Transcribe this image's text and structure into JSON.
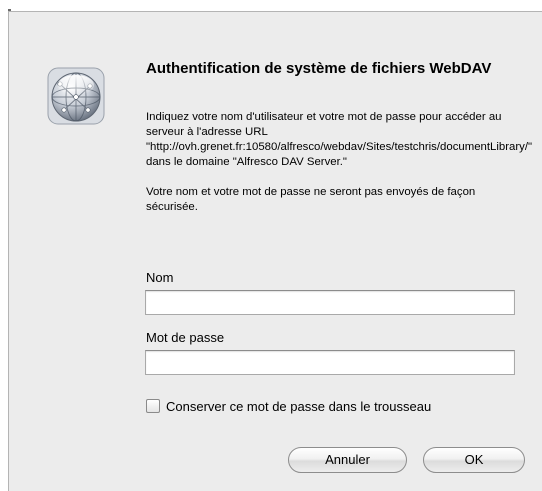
{
  "dialog": {
    "title": "Authentification de système de fichiers WebDAV",
    "message_paragraphs": [
      "Indiquez votre nom d'utilisateur et votre mot de passe pour accéder au serveur à l'adresse URL \"http://ovh.grenet.fr:10580/alfresco/webdav/Sites/testchris/documentLibrary/\" dans le domaine \"Alfresco DAV Server.\"",
      "Votre nom et votre mot de passe ne seront pas envoyés de façon sécurisée."
    ],
    "icon": "network-globe-icon"
  },
  "form": {
    "name_label": "Nom",
    "name_value": "",
    "password_label": "Mot de passe",
    "password_value": "",
    "keychain_checkbox_label": "Conserver ce mot de passe dans le trousseau",
    "keychain_checked": false
  },
  "buttons": {
    "cancel_label": "Annuler",
    "ok_label": "OK"
  },
  "colors": {
    "dialog_background": "#ececec",
    "field_background": "#ffffff",
    "field_border": "#a9a9a9"
  }
}
